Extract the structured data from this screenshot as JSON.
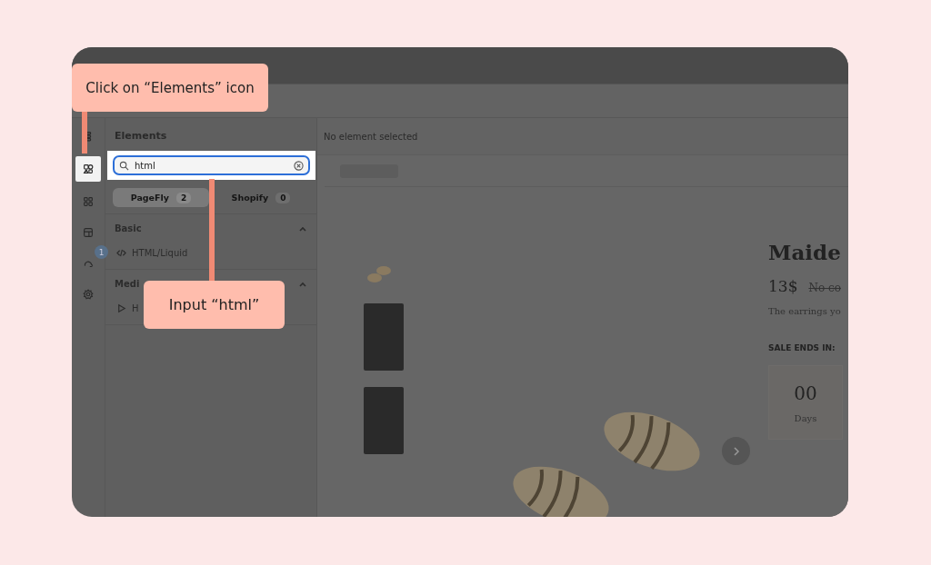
{
  "callouts": [
    {
      "text": "Click on “Elements” icon"
    },
    {
      "text": "Input “html”"
    }
  ],
  "rail": [
    {
      "kind": "layers",
      "selected": false
    },
    {
      "kind": "elements",
      "selected": true
    },
    {
      "kind": "sections",
      "selected": false
    },
    {
      "kind": "pages",
      "selected": false
    },
    {
      "kind": "publish",
      "selected": false,
      "badge": "1"
    },
    {
      "kind": "settings",
      "selected": false
    }
  ],
  "panel": {
    "title": "Elements",
    "search": {
      "value": "html"
    },
    "tabs": [
      {
        "label": "PageFly",
        "count": "2",
        "selected": true
      },
      {
        "label": "Shopify",
        "count": "0",
        "selected": false
      }
    ],
    "sections": [
      {
        "title": "Basic",
        "expanded": true,
        "items": [
          {
            "kind": "code",
            "label": "HTML/Liquid"
          }
        ]
      },
      {
        "title": "Medi",
        "expanded": true,
        "items": [
          {
            "kind": "play",
            "label": "H"
          }
        ]
      }
    ]
  },
  "canvas": {
    "status": "No element selected",
    "product": {
      "title": "Maide",
      "price": "13$",
      "old_price": "No co",
      "description": "The earrings yo",
      "sale_label": "SALE ENDS IN:",
      "countdown": [
        {
          "value": "00",
          "unit": "Days"
        }
      ]
    }
  }
}
